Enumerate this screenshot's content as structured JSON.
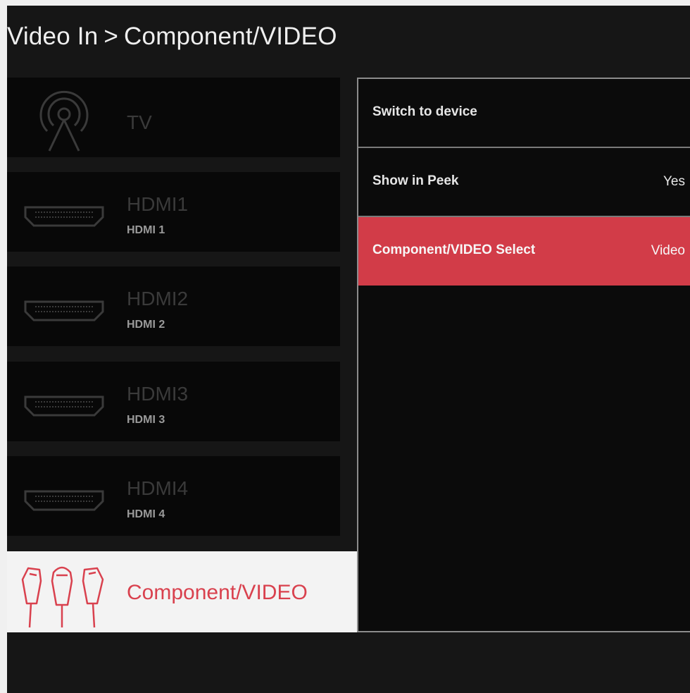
{
  "breadcrumb": {
    "parent": "Video In",
    "separator": ">",
    "current": "Component/VIDEO"
  },
  "sources": [
    {
      "name": "TV",
      "sub": "",
      "icon": "antenna-icon",
      "selected": false
    },
    {
      "name": "HDMI1",
      "sub": "HDMI 1",
      "icon": "hdmi-port-icon",
      "selected": false
    },
    {
      "name": "HDMI2",
      "sub": "HDMI 2",
      "icon": "hdmi-port-icon",
      "selected": false
    },
    {
      "name": "HDMI3",
      "sub": "HDMI 3",
      "icon": "hdmi-port-icon",
      "selected": false
    },
    {
      "name": "HDMI4",
      "sub": "HDMI 4",
      "icon": "hdmi-port-icon",
      "selected": false
    },
    {
      "name": "Component/VIDEO",
      "sub": "",
      "icon": "rca-cables-icon",
      "selected": true
    }
  ],
  "options": [
    {
      "label": "Switch to device",
      "value": ""
    },
    {
      "label": "Show in Peek",
      "value": "Yes"
    },
    {
      "label": "Component/VIDEO Select",
      "value": "Video",
      "highlighted": true
    }
  ],
  "colors": {
    "accent": "#d23c48",
    "background": "#161616",
    "tile": "#080808",
    "selected_tile": "#f3f3f3"
  }
}
